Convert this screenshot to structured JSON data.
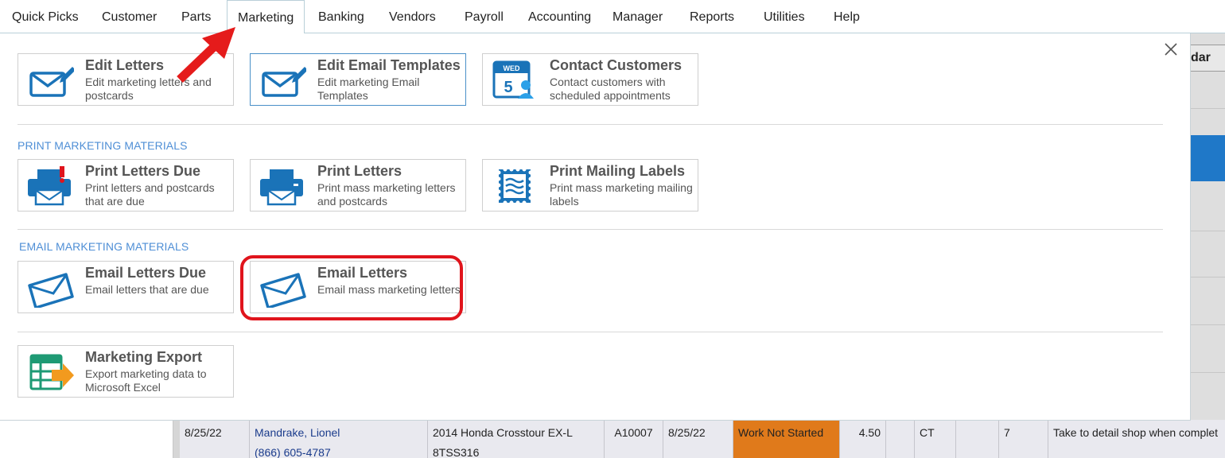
{
  "menu": {
    "items": [
      "Quick Picks",
      "Customer",
      "Parts",
      "Marketing",
      "Banking",
      "Vendors",
      "Payroll",
      "Accounting",
      "Manager",
      "Reports",
      "Utilities",
      "Help"
    ],
    "active": "Marketing"
  },
  "background": {
    "calendar_button_fragment": "dar",
    "row": {
      "date": "8/25/22",
      "customer": "Mandrake, Lionel",
      "phone": "(866) 605-4787",
      "vehicle": "2014 Honda  Crosstour EX-L",
      "plate": "8TSS316",
      "ro_number": "A10007",
      "promised": "8/25/22",
      "status": "Work Not Started",
      "hours": "4.50",
      "tech": "CT",
      "qty": "7",
      "note": "Take to detail shop when complet"
    }
  },
  "marketing": {
    "tiles_top": [
      {
        "title": "Edit Letters",
        "desc": "Edit marketing letters and postcards",
        "icon": "edit-envelope-icon"
      },
      {
        "title": "Edit Email Templates",
        "desc": "Edit marketing Email Templates",
        "icon": "edit-envelope-icon"
      },
      {
        "title": "Contact Customers",
        "desc": "Contact customers with scheduled appointments",
        "icon": "calendar-person-icon",
        "calendar_day": "WED",
        "calendar_date": "5"
      }
    ],
    "print_section": {
      "label": "PRINT MARKETING MATERIALS",
      "tiles": [
        {
          "title": "Print Letters Due",
          "desc": "Print letters and postcards that are due",
          "icon": "printer-alert-icon"
        },
        {
          "title": "Print Letters",
          "desc": "Print mass marketing letters and postcards",
          "icon": "printer-icon"
        },
        {
          "title": "Print Mailing Labels",
          "desc": "Print mass marketing mailing labels",
          "icon": "stamp-icon"
        }
      ]
    },
    "email_section": {
      "label": "EMAIL MARKETING MATERIALS",
      "tiles": [
        {
          "title": "Email Letters Due",
          "desc": "Email letters that are due",
          "icon": "envelope-icon"
        },
        {
          "title": "Email Letters",
          "desc": "Email mass marketing letters",
          "icon": "envelope-icon"
        }
      ]
    },
    "export_tile": {
      "title": "Marketing Export",
      "desc": "Export marketing data to Microsoft Excel",
      "icon": "excel-export-icon"
    }
  },
  "colors": {
    "icon_blue": "#1a73b8",
    "section_label": "#4f8fd6",
    "highlight": "#e0141c",
    "status_orange": "#e07a1b",
    "export_green": "#1e9a74",
    "export_orange": "#f29a1e"
  }
}
